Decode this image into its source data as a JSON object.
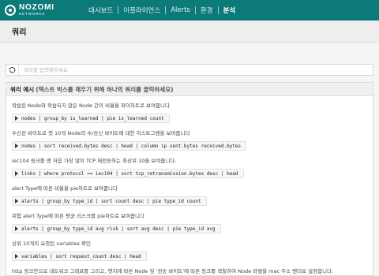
{
  "brand": {
    "name": "NOZOMI",
    "sub": "NETWORKS"
  },
  "nav": {
    "items": [
      "대시보드",
      "어플라이언스",
      "Alerts",
      "환경",
      "분석"
    ],
    "active_index": 4
  },
  "page": {
    "title": "쿼리"
  },
  "search": {
    "placeholder": "쿼리를 입력해주세요",
    "value": ""
  },
  "examples": {
    "title": "쿼리 예시",
    "subtitle": "(텍스트 박스를 채우기 위해 하나의 쿼리를 클릭하세요)",
    "items": [
      {
        "desc": "학습된 Node와 학습되지 않은 Node 간의 비율을 파이차트로 보여줍니다",
        "query": "nodes | group_by is_learned | pie is_learned count"
      },
      {
        "desc": "수신된 바이트로 첫 10개 Node의 수/송신 바이트에 대한 히스토그램을 보여줍니다",
        "query": "nodes | sort received.bytes desc | head | column ip sent.bytes received.bytes"
      },
      {
        "desc": "iec104 링크를 맨 처음 가장 많이 TCP 재전송하는 최상위 10을 보여줍니다.",
        "query": "links | where protocol == iec104 | sort tcp_retransmission.bytes desc | head"
      },
      {
        "desc": "alert Type에 따른 비율을 pie차트로 보여줍니다",
        "query": "alerts | group_by type_id | sort count desc | pie type_id count"
      },
      {
        "desc": "위험 alert Type에 따른 평균 리스크를 pie차트로 보여줍니다",
        "query": "alerts | group_by type_id avg risk | sort avg desc | pie type_id avg"
      },
      {
        "desc": "상위 10개의 요청된 variables 확인",
        "query": "variables | sort request_count desc | head"
      },
      {
        "desc": "http 링크만으로 네트워크 그래프를 그리고, 엣지에 따른 Node 및 '전송 바이트'에 따른 링크를 색칠하여 Node 라벨을 mac 주소 벤더로 설정합니다.",
        "query": ""
      }
    ]
  },
  "colors": {
    "topbar": "#0b7a78",
    "background": "#f5f5f5"
  }
}
